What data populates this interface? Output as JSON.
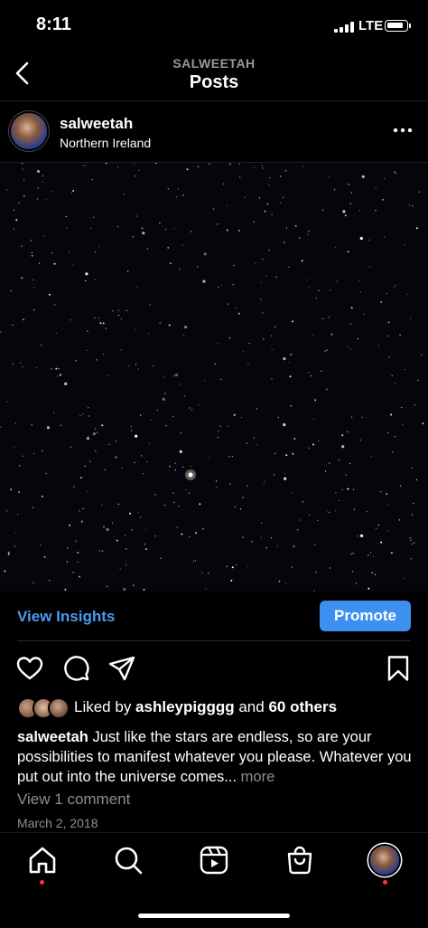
{
  "status_bar": {
    "time": "8:11",
    "network": "LTE",
    "battery_icon": "battery-icon",
    "signal_icon": "cellular-signal-icon"
  },
  "header": {
    "subtitle": "SALWEETAH",
    "title": "Posts",
    "back_icon": "chevron-left-icon"
  },
  "post": {
    "username": "salweetah",
    "location": "Northern Ireland",
    "options_icon": "more-horizontal-icon",
    "image_description_icon": "starry-night-sky-image",
    "insights_label": "View Insights",
    "promote_label": "Promote",
    "actions": [
      "heart-icon",
      "comment-icon",
      "share-icon",
      "bookmark-icon"
    ],
    "likes": {
      "prefix": "Liked by ",
      "user": "ashleypigggg",
      "middle": " and ",
      "others": "60 others"
    },
    "caption": {
      "user": "salweetah",
      "text": "Just like the stars are endless, so are your possibilities to manifest whatever you please. Whatever you put out into the universe comes...",
      "more": "more"
    },
    "view_comments": "View 1 comment",
    "date": "March 2, 2018"
  },
  "nav": {
    "items": [
      "home-icon",
      "search-icon",
      "reels-icon",
      "shop-icon",
      "profile-avatar"
    ]
  },
  "colors": {
    "accent": "#3d8ff0",
    "link": "#4a9bf5",
    "muted": "#8e8e8e",
    "notification": "#ff3040"
  }
}
